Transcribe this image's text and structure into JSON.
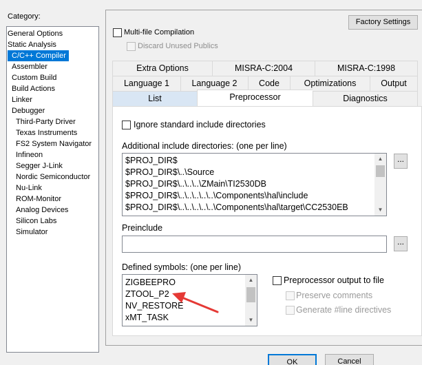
{
  "category": {
    "label": "Category:",
    "items": [
      "General Options",
      "Static Analysis",
      "C/C++ Compiler",
      "Assembler",
      "Custom Build",
      "Build Actions",
      "Linker",
      "Debugger",
      "Third-Party Driver",
      "Texas Instruments",
      "FS2 System Navigator",
      "Infineon",
      "Segger J-Link",
      "Nordic Semiconductor",
      "Nu-Link",
      "ROM-Monitor",
      "Analog Devices",
      "Silicon Labs",
      "Simulator"
    ],
    "selected": "C/C++ Compiler"
  },
  "factory_settings": "Factory Settings",
  "multifile": {
    "label": "Multi-file Compilation",
    "checked": false
  },
  "discard_publics": {
    "label": "Discard Unused Publics",
    "checked": false
  },
  "tabs": {
    "row1": [
      "Extra Options",
      "MISRA-C:2004",
      "MISRA-C:1998"
    ],
    "row2": [
      "Language 1",
      "Language 2",
      "Code",
      "Optimizations",
      "Output"
    ],
    "row3": [
      "List",
      "Preprocessor",
      "Diagnostics"
    ],
    "selected": "Preprocessor"
  },
  "preprocessor": {
    "ignore_std": "Ignore standard include directories",
    "additional_label": "Additional include directories: (one per line)",
    "include_dirs": [
      "$PROJ_DIR$",
      "$PROJ_DIR$\\..\\Source",
      "$PROJ_DIR$\\..\\..\\..\\ZMain\\TI2530DB",
      "$PROJ_DIR$\\..\\..\\..\\..\\..\\Components\\hal\\include",
      "$PROJ_DIR$\\..\\..\\..\\..\\..\\Components\\hal\\target\\CC2530EB"
    ],
    "browse": "...",
    "preinclude_label": "Preinclude",
    "preinclude_value": "",
    "defined_label": "Defined symbols: (one per line)",
    "symbols": [
      "ZIGBEEPRO",
      "ZTOOL_P2",
      "NV_RESTORE",
      "xMT_TASK"
    ],
    "pp_output": "Preprocessor output to file",
    "preserve_comments": "Preserve comments",
    "generate_line": "Generate #line directives"
  },
  "buttons": {
    "ok": "OK",
    "cancel": "Cancel"
  },
  "colors": {
    "selection": "#0078d7",
    "arrow": "#e53935",
    "active_tab": "#d9e6f4"
  }
}
